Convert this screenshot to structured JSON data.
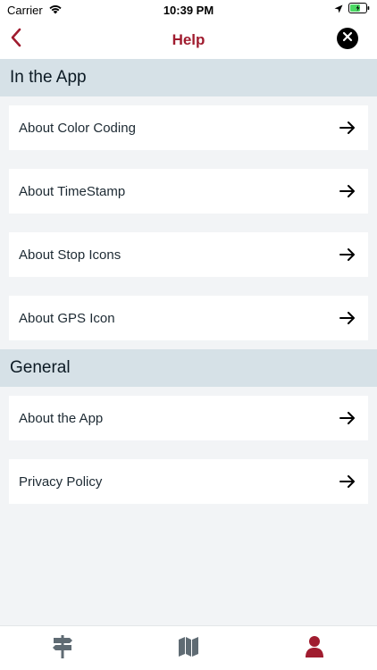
{
  "status_bar": {
    "carrier": "Carrier",
    "time": "10:39 PM"
  },
  "nav": {
    "title": "Help",
    "back_icon": "chevron-left-icon",
    "close_icon": "close-icon"
  },
  "sections": [
    {
      "header": "In the App",
      "items": [
        {
          "label": "About Color Coding"
        },
        {
          "label": "About TimeStamp"
        },
        {
          "label": "About Stop Icons"
        },
        {
          "label": "About GPS Icon"
        }
      ]
    },
    {
      "header": "General",
      "items": [
        {
          "label": "About the App"
        },
        {
          "label": "Privacy Policy"
        }
      ]
    }
  ],
  "tab_bar": {
    "tabs": [
      {
        "icon": "signpost-icon",
        "active": false
      },
      {
        "icon": "map-icon",
        "active": false
      },
      {
        "icon": "user-icon",
        "active": true
      }
    ]
  },
  "colors": {
    "accent": "#a01c2f",
    "section_bg": "#d6e1e7",
    "page_bg": "#f2f4f6",
    "inactive_tab": "#5f6b73"
  }
}
